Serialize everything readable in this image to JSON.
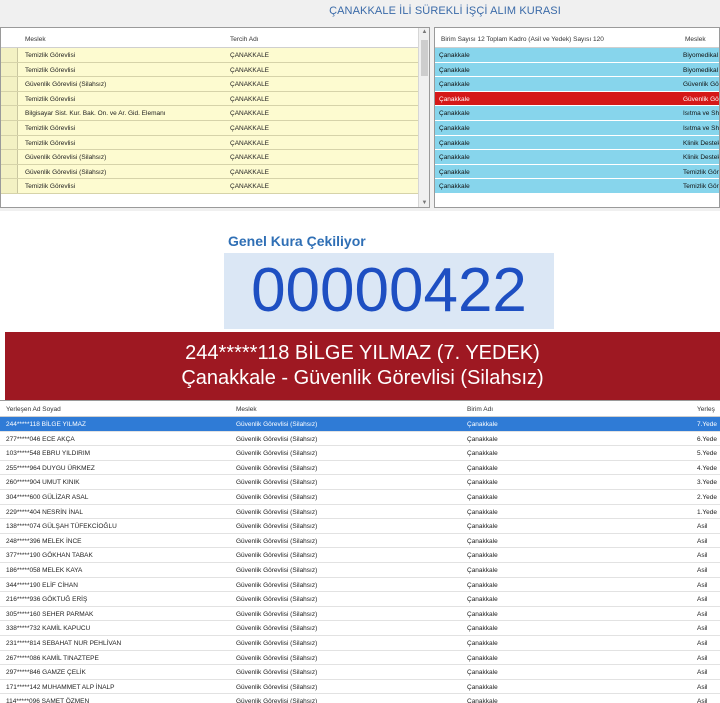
{
  "app": {
    "title": "ÇANAKKALE İLİ SÜREKLİ İŞÇİ ALIM KURASI"
  },
  "left_grid": {
    "headers": {
      "meslek": "Meslek",
      "tercih_adi": "Tercih Adı"
    },
    "rows": [
      {
        "meslek": "Temizlik Görevlisi",
        "tercih": "ÇANAKKALE"
      },
      {
        "meslek": "Temizlik Görevlisi",
        "tercih": "ÇANAKKALE"
      },
      {
        "meslek": "Güvenlik Görevlisi (Silahsız)",
        "tercih": "ÇANAKKALE"
      },
      {
        "meslek": "Temizlik Görevlisi",
        "tercih": "ÇANAKKALE"
      },
      {
        "meslek": "Bilgisayar Sist. Kur. Bak. On. ve Ar. Gid. Elemanı",
        "tercih": "ÇANAKKALE"
      },
      {
        "meslek": "Temizlik Görevlisi",
        "tercih": "ÇANAKKALE"
      },
      {
        "meslek": "Temizlik Görevlisi",
        "tercih": "ÇANAKKALE"
      },
      {
        "meslek": "Güvenlik Görevlisi (Silahsız)",
        "tercih": "ÇANAKKALE"
      },
      {
        "meslek": "Güvenlik Görevlisi (Silahsız)",
        "tercih": "ÇANAKKALE"
      },
      {
        "meslek": "Temizlik Görevlisi",
        "tercih": "ÇANAKKALE"
      }
    ]
  },
  "right_grid": {
    "headers": {
      "summary": "Birim Sayısı 12 Toplam Kadro (Asil ve Yedek) Sayısı 120",
      "meslek": "Meslek"
    },
    "selected_color": "#d51818",
    "rows": [
      {
        "birim": "Çanakkale",
        "meslek": "Biyomedikal"
      },
      {
        "birim": "Çanakkale",
        "meslek": "Biyomedikal"
      },
      {
        "birim": "Çanakkale",
        "meslek": "Güvenlik Gö"
      },
      {
        "birim": "Çanakkale",
        "meslek": "Güvenlik Gö",
        "selected": true
      },
      {
        "birim": "Çanakkale",
        "meslek": "Isıtma ve Sh"
      },
      {
        "birim": "Çanakkale",
        "meslek": "Isıtma ve Sh"
      },
      {
        "birim": "Çanakkale",
        "meslek": "Klinik Destek"
      },
      {
        "birim": "Çanakkale",
        "meslek": "Klinik Destek"
      },
      {
        "birim": "Çanakkale",
        "meslek": "Temizlik Gör"
      },
      {
        "birim": "Çanakkale",
        "meslek": "Temizlik Göre"
      }
    ]
  },
  "draw": {
    "label": "Genel Kura Çekiliyor",
    "number": "00000422",
    "winner_line1": "244*****118 BİLGE YILMAZ (7. YEDEK)",
    "winner_line2": "Çanakkale - Güvenlik Görevlisi (Silahsız)",
    "band_color": "#9e1822",
    "number_color": "#1e4fc2"
  },
  "results": {
    "headers": {
      "ad_soyad": "Yerleşen Ad Soyad",
      "meslek": "Meslek",
      "birim": "Birim Adı",
      "yerlesme": "Yerleş"
    },
    "selected_color": "#2f7bd6",
    "rows": [
      {
        "name": "244*****118 BİLGE YILMAZ",
        "meslek": "Güvenlik Görevlisi (Silahsız)",
        "birim": "Çanakkale",
        "durum": "7.Yede",
        "selected": true
      },
      {
        "name": "277*****046 ECE AKÇA",
        "meslek": "Güvenlik Görevlisi (Silahsız)",
        "birim": "Çanakkale",
        "durum": "6.Yede"
      },
      {
        "name": "103*****548 EBRU YILDIRIM",
        "meslek": "Güvenlik Görevlisi (Silahsız)",
        "birim": "Çanakkale",
        "durum": "5.Yede"
      },
      {
        "name": "255*****964 DUYGU ÜRKMEZ",
        "meslek": "Güvenlik Görevlisi (Silahsız)",
        "birim": "Çanakkale",
        "durum": "4.Yede"
      },
      {
        "name": "260*****904 UMUT KINIK",
        "meslek": "Güvenlik Görevlisi (Silahsız)",
        "birim": "Çanakkale",
        "durum": "3.Yede"
      },
      {
        "name": "304*****600 GÜLİZAR ASAL",
        "meslek": "Güvenlik Görevlisi (Silahsız)",
        "birim": "Çanakkale",
        "durum": "2.Yede"
      },
      {
        "name": "229*****404 NESRİN İNAL",
        "meslek": "Güvenlik Görevlisi (Silahsız)",
        "birim": "Çanakkale",
        "durum": "1.Yede"
      },
      {
        "name": "138*****074 GÜLŞAH TÜFEKCİOĞLU",
        "meslek": "Güvenlik Görevlisi (Silahsız)",
        "birim": "Çanakkale",
        "durum": "Asil"
      },
      {
        "name": "248*****396 MELEK İNCE",
        "meslek": "Güvenlik Görevlisi (Silahsız)",
        "birim": "Çanakkale",
        "durum": "Asil"
      },
      {
        "name": "377*****190 GÖKHAN TABAK",
        "meslek": "Güvenlik Görevlisi (Silahsız)",
        "birim": "Çanakkale",
        "durum": "Asil"
      },
      {
        "name": "186*****058 MELEK KAYA",
        "meslek": "Güvenlik Görevlisi (Silahsız)",
        "birim": "Çanakkale",
        "durum": "Asil"
      },
      {
        "name": "344*****190 ELİF CİHAN",
        "meslek": "Güvenlik Görevlisi (Silahsız)",
        "birim": "Çanakkale",
        "durum": "Asil"
      },
      {
        "name": "216*****936 GÖKTUĞ ERİŞ",
        "meslek": "Güvenlik Görevlisi (Silahsız)",
        "birim": "Çanakkale",
        "durum": "Asil"
      },
      {
        "name": "305*****160 SEHER PARMAK",
        "meslek": "Güvenlik Görevlisi (Silahsız)",
        "birim": "Çanakkale",
        "durum": "Asil"
      },
      {
        "name": "338*****732 KAMİL KAPUCU",
        "meslek": "Güvenlik Görevlisi (Silahsız)",
        "birim": "Çanakkale",
        "durum": "Asil"
      },
      {
        "name": "231*****814 SEBAHAT NUR PEHLİVAN",
        "meslek": "Güvenlik Görevlisi (Silahsız)",
        "birim": "Çanakkale",
        "durum": "Asil"
      },
      {
        "name": "267*****086 KAMİL TINAZTEPE",
        "meslek": "Güvenlik Görevlisi (Silahsız)",
        "birim": "Çanakkale",
        "durum": "Asil"
      },
      {
        "name": "297*****846 GAMZE ÇELİK",
        "meslek": "Güvenlik Görevlisi (Silahsız)",
        "birim": "Çanakkale",
        "durum": "Asil"
      },
      {
        "name": "171*****142 MUHAMMET ALP İNALP",
        "meslek": "Güvenlik Görevlisi (Silahsız)",
        "birim": "Çanakkale",
        "durum": "Asil"
      },
      {
        "name": "114*****096 SAMET ÖZMEN",
        "meslek": "Güvenlik Görevlisi (Silahsız)",
        "birim": "Çanakkale",
        "durum": "Asil"
      }
    ]
  }
}
